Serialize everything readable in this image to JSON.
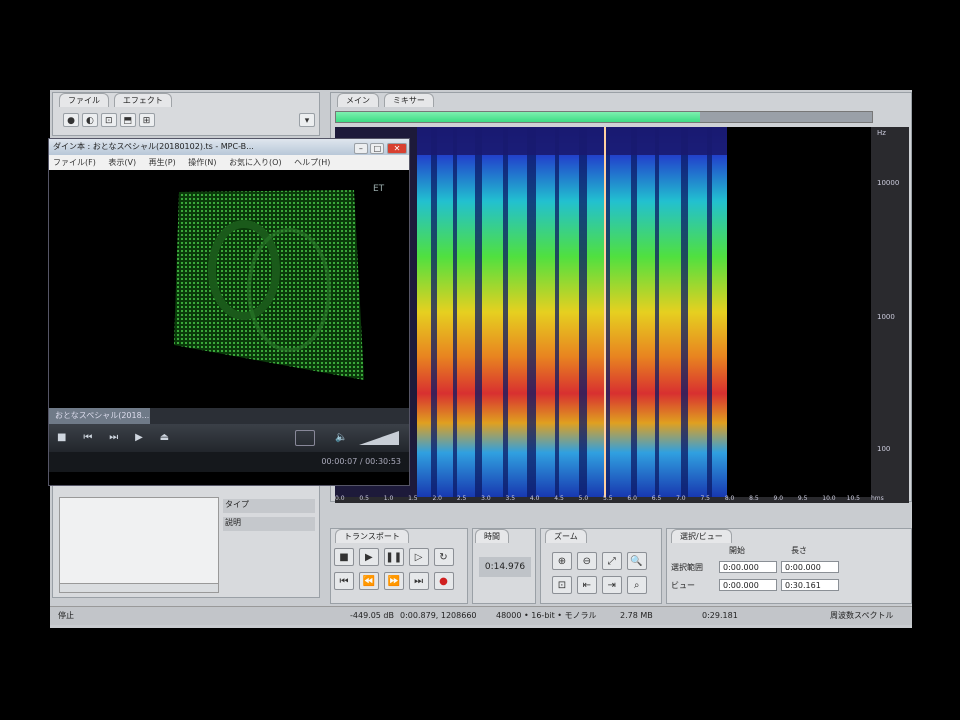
{
  "app": {
    "left_panel_tabs": [
      "ファイル",
      "エフェクト"
    ],
    "main_tabs": [
      "メイン",
      "ミキサー"
    ],
    "status_left": "停止",
    "status_items": [
      "-449.05 dB",
      "0:00.879, 1208660",
      "48000 • 16-bit • モノラル",
      "2.78 MB",
      "0:29.181",
      "周波数スペクトル"
    ],
    "freq_labels": [
      "Hz",
      "10000",
      "1000",
      "100"
    ],
    "time_labels": [
      "0.0",
      "0.5",
      "1.0",
      "1.5",
      "2.0",
      "2.5",
      "3.0",
      "3.5",
      "4.0",
      "4.5",
      "5.0",
      "5.5",
      "6.0",
      "6.5",
      "7.0",
      "7.5",
      "8.0",
      "8.5",
      "9.0",
      "9.5",
      "10.0",
      "10.5",
      "hms"
    ],
    "transport_title": "トランスポート",
    "time_title": "時間",
    "time_value": "0:14.976",
    "zoom_title": "ズーム",
    "selection_title": "選択/ビュー",
    "selection_headers": [
      "開始",
      "長さ"
    ],
    "selection_rows": [
      {
        "label": "選択範囲",
        "start": "0:00.000",
        "length": "0:00.000"
      },
      {
        "label": "ビュー",
        "start": "0:00.000",
        "length": "0:30.161"
      }
    ],
    "props": {
      "type_label": "タイプ",
      "desc_label": "説明"
    }
  },
  "player": {
    "title": "ダイン本 : おとなスペシャル(20180102).ts - MPC-B...",
    "menu": [
      "ファイル(F)",
      "表示(V)",
      "再生(P)",
      "操作(N)",
      "お気に入り(O)",
      "ヘルプ(H)"
    ],
    "overlay_label": "ET",
    "seek_file": "おとなスペシャル(2018...",
    "time_display": "00:00:07 / 00:30:53",
    "buttons": [
      "■",
      "⏮",
      "⏭",
      "▶",
      "⏏"
    ]
  },
  "colors": {
    "accent": "#3ddc84",
    "playhead": "#3ddc84"
  }
}
